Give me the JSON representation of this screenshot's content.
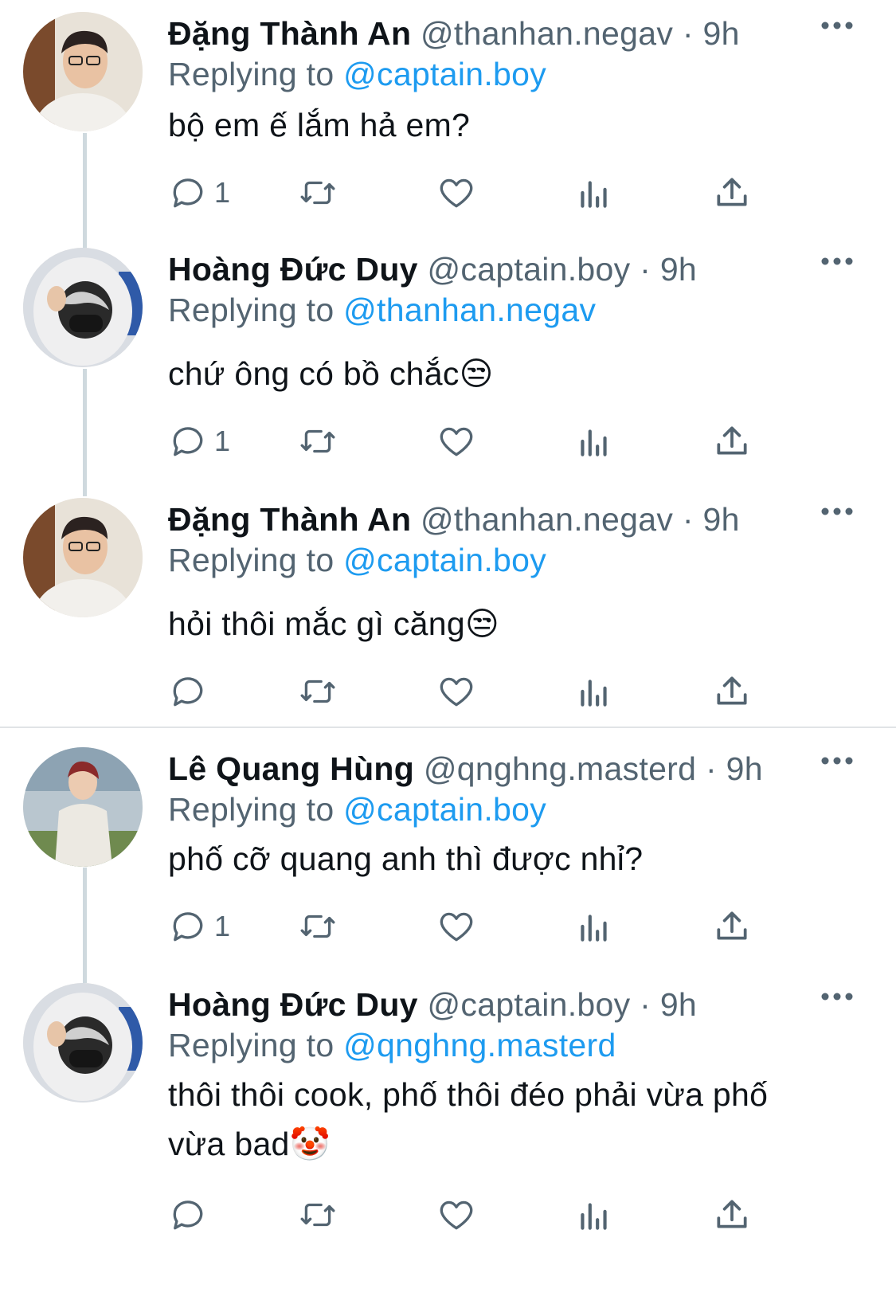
{
  "tweets": [
    {
      "name": "Đặng Thành An",
      "handle": "@thanhan.negav",
      "time": "9h",
      "replying_prefix": "Replying to",
      "replying_to": "@captain.boy",
      "text": "bộ em ế lắm hả em?",
      "reply_count": "1"
    },
    {
      "name": "Hoàng Đức Duy",
      "handle": "@captain.boy",
      "time": "9h",
      "replying_prefix": "Replying to",
      "replying_to": "@thanhan.negav",
      "text": "chứ ông có bồ chắc😒",
      "reply_count": "1"
    },
    {
      "name": "Đặng Thành An",
      "handle": "@thanhan.negav",
      "time": "9h",
      "replying_prefix": "Replying to",
      "replying_to": "@captain.boy",
      "text": "hỏi thôi mắc gì căng😒",
      "reply_count": ""
    },
    {
      "name": "Lê Quang Hùng",
      "handle": "@qnghng.masterd",
      "time": "9h",
      "replying_prefix": "Replying to",
      "replying_to": "@captain.boy",
      "text": "phố cỡ quang anh thì được nhỉ?",
      "reply_count": "1"
    },
    {
      "name": "Hoàng Đức Duy",
      "handle": "@captain.boy",
      "time": "9h",
      "replying_prefix": "Replying to",
      "replying_to": "@qnghng.masterd",
      "text": "thôi thôi cook, phố thôi đéo phải vừa phố vừa bad🤡",
      "reply_count": ""
    }
  ],
  "separator": "·",
  "icons": {
    "reply": "reply-icon",
    "retweet": "retweet-icon",
    "like": "heart-icon",
    "views": "views-icon",
    "share": "share-icon",
    "more": "more-icon"
  },
  "colors": {
    "mention": "#1d9bf0",
    "secondary_text": "#536471",
    "primary_text": "#0f1419",
    "thread_line": "#cfd9de"
  }
}
